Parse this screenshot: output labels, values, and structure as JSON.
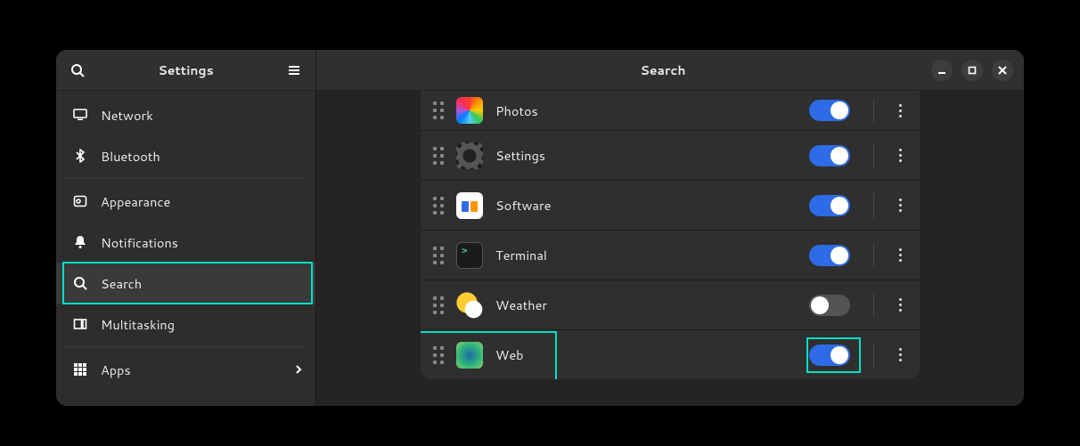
{
  "window": {
    "app_title": "Settings",
    "page_title": "Search"
  },
  "sidebar": {
    "items": [
      {
        "id": "network",
        "label": "Network",
        "icon": "monitor-icon",
        "separator_after": false,
        "has_submenu": false
      },
      {
        "id": "bluetooth",
        "label": "Bluetooth",
        "icon": "bluetooth-icon",
        "separator_after": true,
        "has_submenu": false
      },
      {
        "id": "appearance",
        "label": "Appearance",
        "icon": "appearance-icon",
        "separator_after": false,
        "has_submenu": false
      },
      {
        "id": "notifications",
        "label": "Notifications",
        "icon": "bell-icon",
        "separator_after": false,
        "has_submenu": false
      },
      {
        "id": "search",
        "label": "Search",
        "icon": "search-icon",
        "separator_after": false,
        "has_submenu": false,
        "active": true
      },
      {
        "id": "multitasking",
        "label": "Multitasking",
        "icon": "multitasking-icon",
        "separator_after": true,
        "has_submenu": false
      },
      {
        "id": "apps",
        "label": "Apps",
        "icon": "apps-icon",
        "separator_after": false,
        "has_submenu": true
      }
    ]
  },
  "search_providers": [
    {
      "id": "photos",
      "label": "Photos",
      "icon": "photos-icon",
      "enabled": true
    },
    {
      "id": "settings",
      "label": "Settings",
      "icon": "settings-icon",
      "enabled": true
    },
    {
      "id": "software",
      "label": "Software",
      "icon": "software-icon",
      "enabled": true
    },
    {
      "id": "terminal",
      "label": "Terminal",
      "icon": "terminal-icon",
      "enabled": true
    },
    {
      "id": "weather",
      "label": "Weather",
      "icon": "weather-icon",
      "enabled": false
    },
    {
      "id": "web",
      "label": "Web",
      "icon": "web-icon",
      "enabled": true
    }
  ],
  "highlights": {
    "sidebar_search_item": true,
    "web_row_left": true,
    "web_row_toggle": true
  },
  "colors": {
    "accent": "#2e6be6",
    "highlight": "#00e0c7",
    "window_bg": "#242424",
    "sidebar_bg": "#2d2d2d"
  }
}
